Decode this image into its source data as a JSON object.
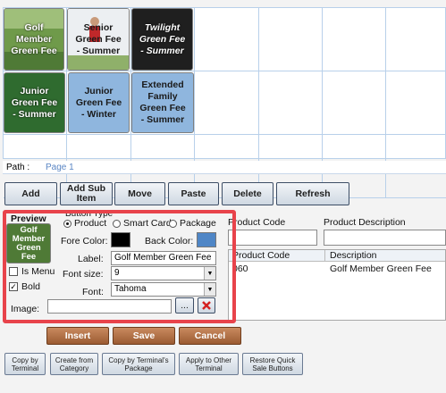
{
  "tiles": [
    {
      "label": "Golf\nMember\nGreen Fee",
      "text_color": "#ffffff",
      "bg": "#4f7a36"
    },
    {
      "label": "Senior\nGreen Fee\n- Summer",
      "text_color": "#1a1a1a",
      "bg": "#e6e6e6"
    },
    {
      "label": "Twilight\nGreen Fee\n- Summer",
      "text_color": "#ffffff",
      "bg": "#1f1f1f"
    },
    {
      "label": "Junior\nGreen Fee\n- Summer",
      "text_color": "#ffffff",
      "bg": "#2f6b2f"
    },
    {
      "label": "Junior\nGreen Fee\n- Winter",
      "text_color": "#1a1a1a",
      "bg": "#8fb6de"
    },
    {
      "label": "Extended\nFamily\nGreen Fee\n- Summer",
      "text_color": "#1a1a1a",
      "bg": "#8fb6de"
    }
  ],
  "path": {
    "label": "Path :",
    "value": "Page 1"
  },
  "toolbar": {
    "add": "Add",
    "add_sub": "Add Sub\nItem",
    "move": "Move",
    "paste": "Paste",
    "delete": "Delete",
    "refresh": "Refresh"
  },
  "editor": {
    "preview_label": "Preview",
    "preview_text": "Golf\nMember\nGreen\nFee",
    "is_menu_label": "Is Menu",
    "bold_label": "Bold",
    "bold_checked": true,
    "button_type_label": "Button Type",
    "type_options": [
      "Product",
      "Smart Card",
      "Package"
    ],
    "selected_type": "Product",
    "fore_color_label": "Fore Color:",
    "fore_color": "#000000",
    "back_color_label": "Back Color:",
    "back_color": "#4f86c6",
    "label_label": "Label:",
    "label_value": "Golf Member Green Fee",
    "font_size_label": "Font size:",
    "font_size_value": "9",
    "font_label": "Font:",
    "font_value": "Tahoma",
    "image_label": "Image:",
    "image_value": "",
    "browse_label": "...",
    "clear_icon": "red-x"
  },
  "product": {
    "code_label": "Product Code",
    "desc_label": "Product Description",
    "col_code": "Product Code",
    "col_desc": "Description",
    "rows": [
      {
        "code": "060",
        "desc": "Golf Member Green Fee"
      }
    ]
  },
  "actions": {
    "insert": "Insert",
    "save": "Save",
    "cancel": "Cancel"
  },
  "bottom": {
    "copy_terminal": "Copy by\nTerminal",
    "create_category": "Create from\nCategory",
    "copy_package": "Copy by Terminal's\nPackage",
    "apply_other": "Apply to Other\nTerminal",
    "restore": "Restore Quick\nSale Buttons"
  }
}
